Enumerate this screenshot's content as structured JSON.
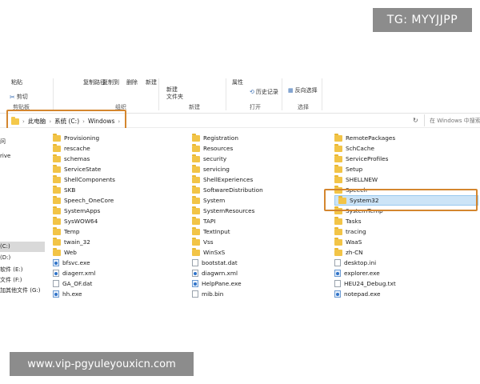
{
  "watermarks": {
    "top_right": "TG: MYYJJPP",
    "bottom_left": "www.vip-pgyuleyouxicn.com"
  },
  "ribbon": {
    "cut_labels": [
      "粘贴",
      "复制路径",
      "复制到",
      "删除",
      "新建",
      "属性"
    ],
    "cut_label": "剪切",
    "history_label": "历史记录",
    "reverse_select_label": "反向选择",
    "new_folder_label": "新建\n文件夹",
    "groups": [
      "剪贴板",
      "组织",
      "新建",
      "打开",
      "选择"
    ]
  },
  "address": {
    "crumbs": [
      "此电脑",
      "系统 (C:)",
      "Windows"
    ],
    "search_placeholder": "在 Windows 中搜索"
  },
  "nav": {
    "items": [
      "问",
      "rive",
      "(C:)",
      "(D:)",
      "软件 (E:)",
      "文件 (F:)",
      "加其他文件 (G:)"
    ]
  },
  "files": {
    "col1": [
      {
        "name": "Provisioning",
        "type": "folder"
      },
      {
        "name": "rescache",
        "type": "folder"
      },
      {
        "name": "schemas",
        "type": "folder"
      },
      {
        "name": "ServiceState",
        "type": "folder"
      },
      {
        "name": "ShellComponents",
        "type": "folder"
      },
      {
        "name": "SKB",
        "type": "folder"
      },
      {
        "name": "Speech_OneCore",
        "type": "folder"
      },
      {
        "name": "SystemApps",
        "type": "folder"
      },
      {
        "name": "SysWOW64",
        "type": "folder"
      },
      {
        "name": "Temp",
        "type": "folder"
      },
      {
        "name": "twain_32",
        "type": "folder"
      },
      {
        "name": "Web",
        "type": "folder"
      },
      {
        "name": "bfsvc.exe",
        "type": "exe"
      },
      {
        "name": "diagerr.xml",
        "type": "xml"
      },
      {
        "name": "GA_OF.dat",
        "type": "dat"
      },
      {
        "name": "hh.exe",
        "type": "exe"
      }
    ],
    "col2": [
      {
        "name": "Registration",
        "type": "folder"
      },
      {
        "name": "Resources",
        "type": "folder"
      },
      {
        "name": "security",
        "type": "folder"
      },
      {
        "name": "servicing",
        "type": "folder"
      },
      {
        "name": "ShellExperiences",
        "type": "folder"
      },
      {
        "name": "SoftwareDistribution",
        "type": "folder"
      },
      {
        "name": "System",
        "type": "folder"
      },
      {
        "name": "SystemResources",
        "type": "folder"
      },
      {
        "name": "TAPI",
        "type": "folder"
      },
      {
        "name": "TextInput",
        "type": "folder"
      },
      {
        "name": "Vss",
        "type": "folder"
      },
      {
        "name": "WinSxS",
        "type": "folder"
      },
      {
        "name": "bootstat.dat",
        "type": "dat"
      },
      {
        "name": "diagwrn.xml",
        "type": "xml"
      },
      {
        "name": "HelpPane.exe",
        "type": "exe"
      },
      {
        "name": "mib.bin",
        "type": "bin"
      }
    ],
    "col3": [
      {
        "name": "RemotePackages",
        "type": "folder"
      },
      {
        "name": "SchCache",
        "type": "folder"
      },
      {
        "name": "ServiceProfiles",
        "type": "folder"
      },
      {
        "name": "Setup",
        "type": "folder"
      },
      {
        "name": "SHELLNEW",
        "type": "folder"
      },
      {
        "name": "Speech",
        "type": "folder"
      },
      {
        "name": "System32",
        "type": "folder",
        "selected": true
      },
      {
        "name": "SystemTemp",
        "type": "folder"
      },
      {
        "name": "Tasks",
        "type": "folder"
      },
      {
        "name": "tracing",
        "type": "folder"
      },
      {
        "name": "WaaS",
        "type": "folder"
      },
      {
        "name": "zh-CN",
        "type": "folder"
      },
      {
        "name": "desktop.ini",
        "type": "ini"
      },
      {
        "name": "explorer.exe",
        "type": "exe"
      },
      {
        "name": "HEU24_Debug.txt",
        "type": "txt"
      },
      {
        "name": "notepad.exe",
        "type": "exe"
      }
    ]
  }
}
